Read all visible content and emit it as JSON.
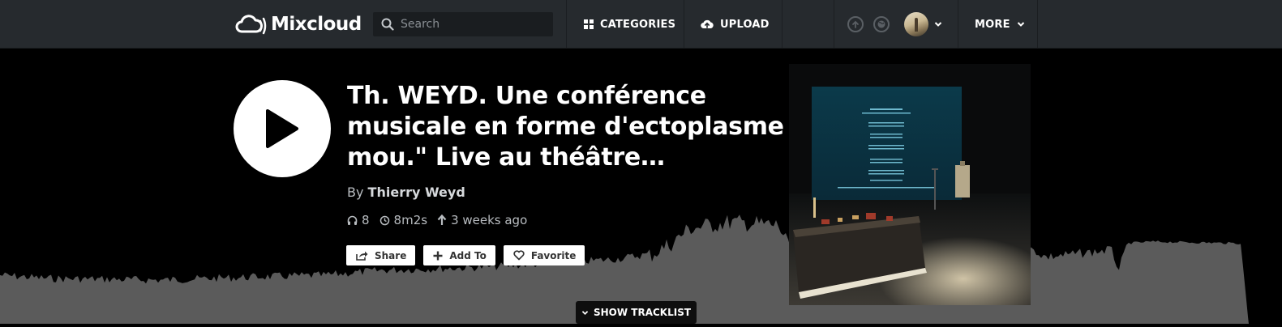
{
  "brand": {
    "name": "Mixcloud"
  },
  "search": {
    "placeholder": "Search"
  },
  "nav": {
    "categories_label": "CATEGORIES",
    "upload_label": "UPLOAD",
    "more_label": "MORE"
  },
  "show": {
    "title": "Th. WEYD. Une conférence musicale en forme d'ectoplasme mou.\" Live au théâtre Berthelot…",
    "by_prefix": "By",
    "author": "Thierry Weyd",
    "plays": "8",
    "duration": "8m2s",
    "uploaded": "3 weeks ago",
    "progress": 0
  },
  "actions": {
    "share_label": "Share",
    "add_to_label": "Add To",
    "favorite_label": "Favorite"
  },
  "tracklist": {
    "label": "SHOW TRACKLIST"
  },
  "colors": {
    "topbar": "#262a2e",
    "background": "#000000",
    "waveform": "#5b5b5b"
  },
  "icons": [
    "mixcloud-cloud-icon",
    "search-icon",
    "grid-icon",
    "upload-cloud-icon",
    "upload-circle-icon",
    "globe-icon",
    "chevron-down-icon",
    "play-icon",
    "headphones-icon",
    "clock-icon",
    "arrow-up-icon",
    "share-icon",
    "plus-icon",
    "heart-icon"
  ]
}
